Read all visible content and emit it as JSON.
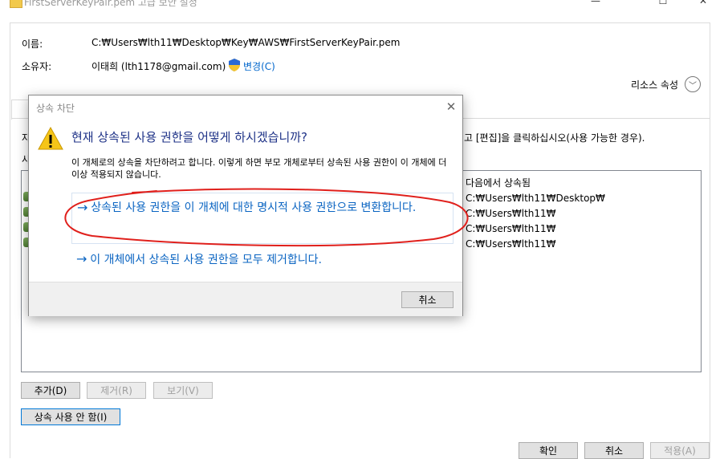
{
  "window": {
    "title": "FirstServerKeyPair.pem 고급 보안 설정",
    "minimize_glyph": "—",
    "maximize_glyph": "☐",
    "close_glyph": "✕"
  },
  "props": {
    "name_label": "이름:",
    "name_value": "C:₩Users₩lth11₩Desktop₩Key₩AWS₩FirstServerKeyPair.pem",
    "owner_label": "소유자:",
    "owner_value": "이태희 (lth1178@gmail.com)",
    "change_link": "변경(C)",
    "resource_props": "리소스 속성",
    "instruction_prefix": "자",
    "instruction_suffix": "고 [편집]을 클릭하십시오(사용 가능한 경우).",
    "section_label": "사"
  },
  "entries_header": "다음에서 상속됨",
  "entries": [
    "C:₩Users₩lth11₩Desktop₩",
    "C:₩Users₩lth11₩",
    "C:₩Users₩lth11₩",
    "C:₩Users₩lth11₩"
  ],
  "buttons": {
    "add": "추가(D)",
    "remove": "제거(R)",
    "view": "보기(V)",
    "disable_inheritance": "상속 사용 안 함(I)",
    "ok": "확인",
    "cancel": "취소",
    "apply": "적용(A)"
  },
  "dialog": {
    "title": "상속 차단",
    "heading": "현재 상속된 사용 권한을 어떻게 하시겠습니까?",
    "description": "이 개체로의 상속을 차단하려고 합니다. 이렇게 하면 부모 개체로부터 상속된 사용 권한이 이 개체에 더 이상 적용되지 않습니다.",
    "option1": "상속된 사용 권한을 이 개체에 대한 명시적 사용 권한으로 변환합니다.",
    "option2": "이 개체에서 상속된 사용 권한을 모두 제거합니다.",
    "arrow_glyph": "→",
    "close_glyph": "✕",
    "cancel": "취소"
  },
  "colors": {
    "accent_blue": "#0a64c2",
    "heading_blue": "#1e3287",
    "annotation_red": "#e0201c",
    "warning_yellow": "#f5c518"
  }
}
